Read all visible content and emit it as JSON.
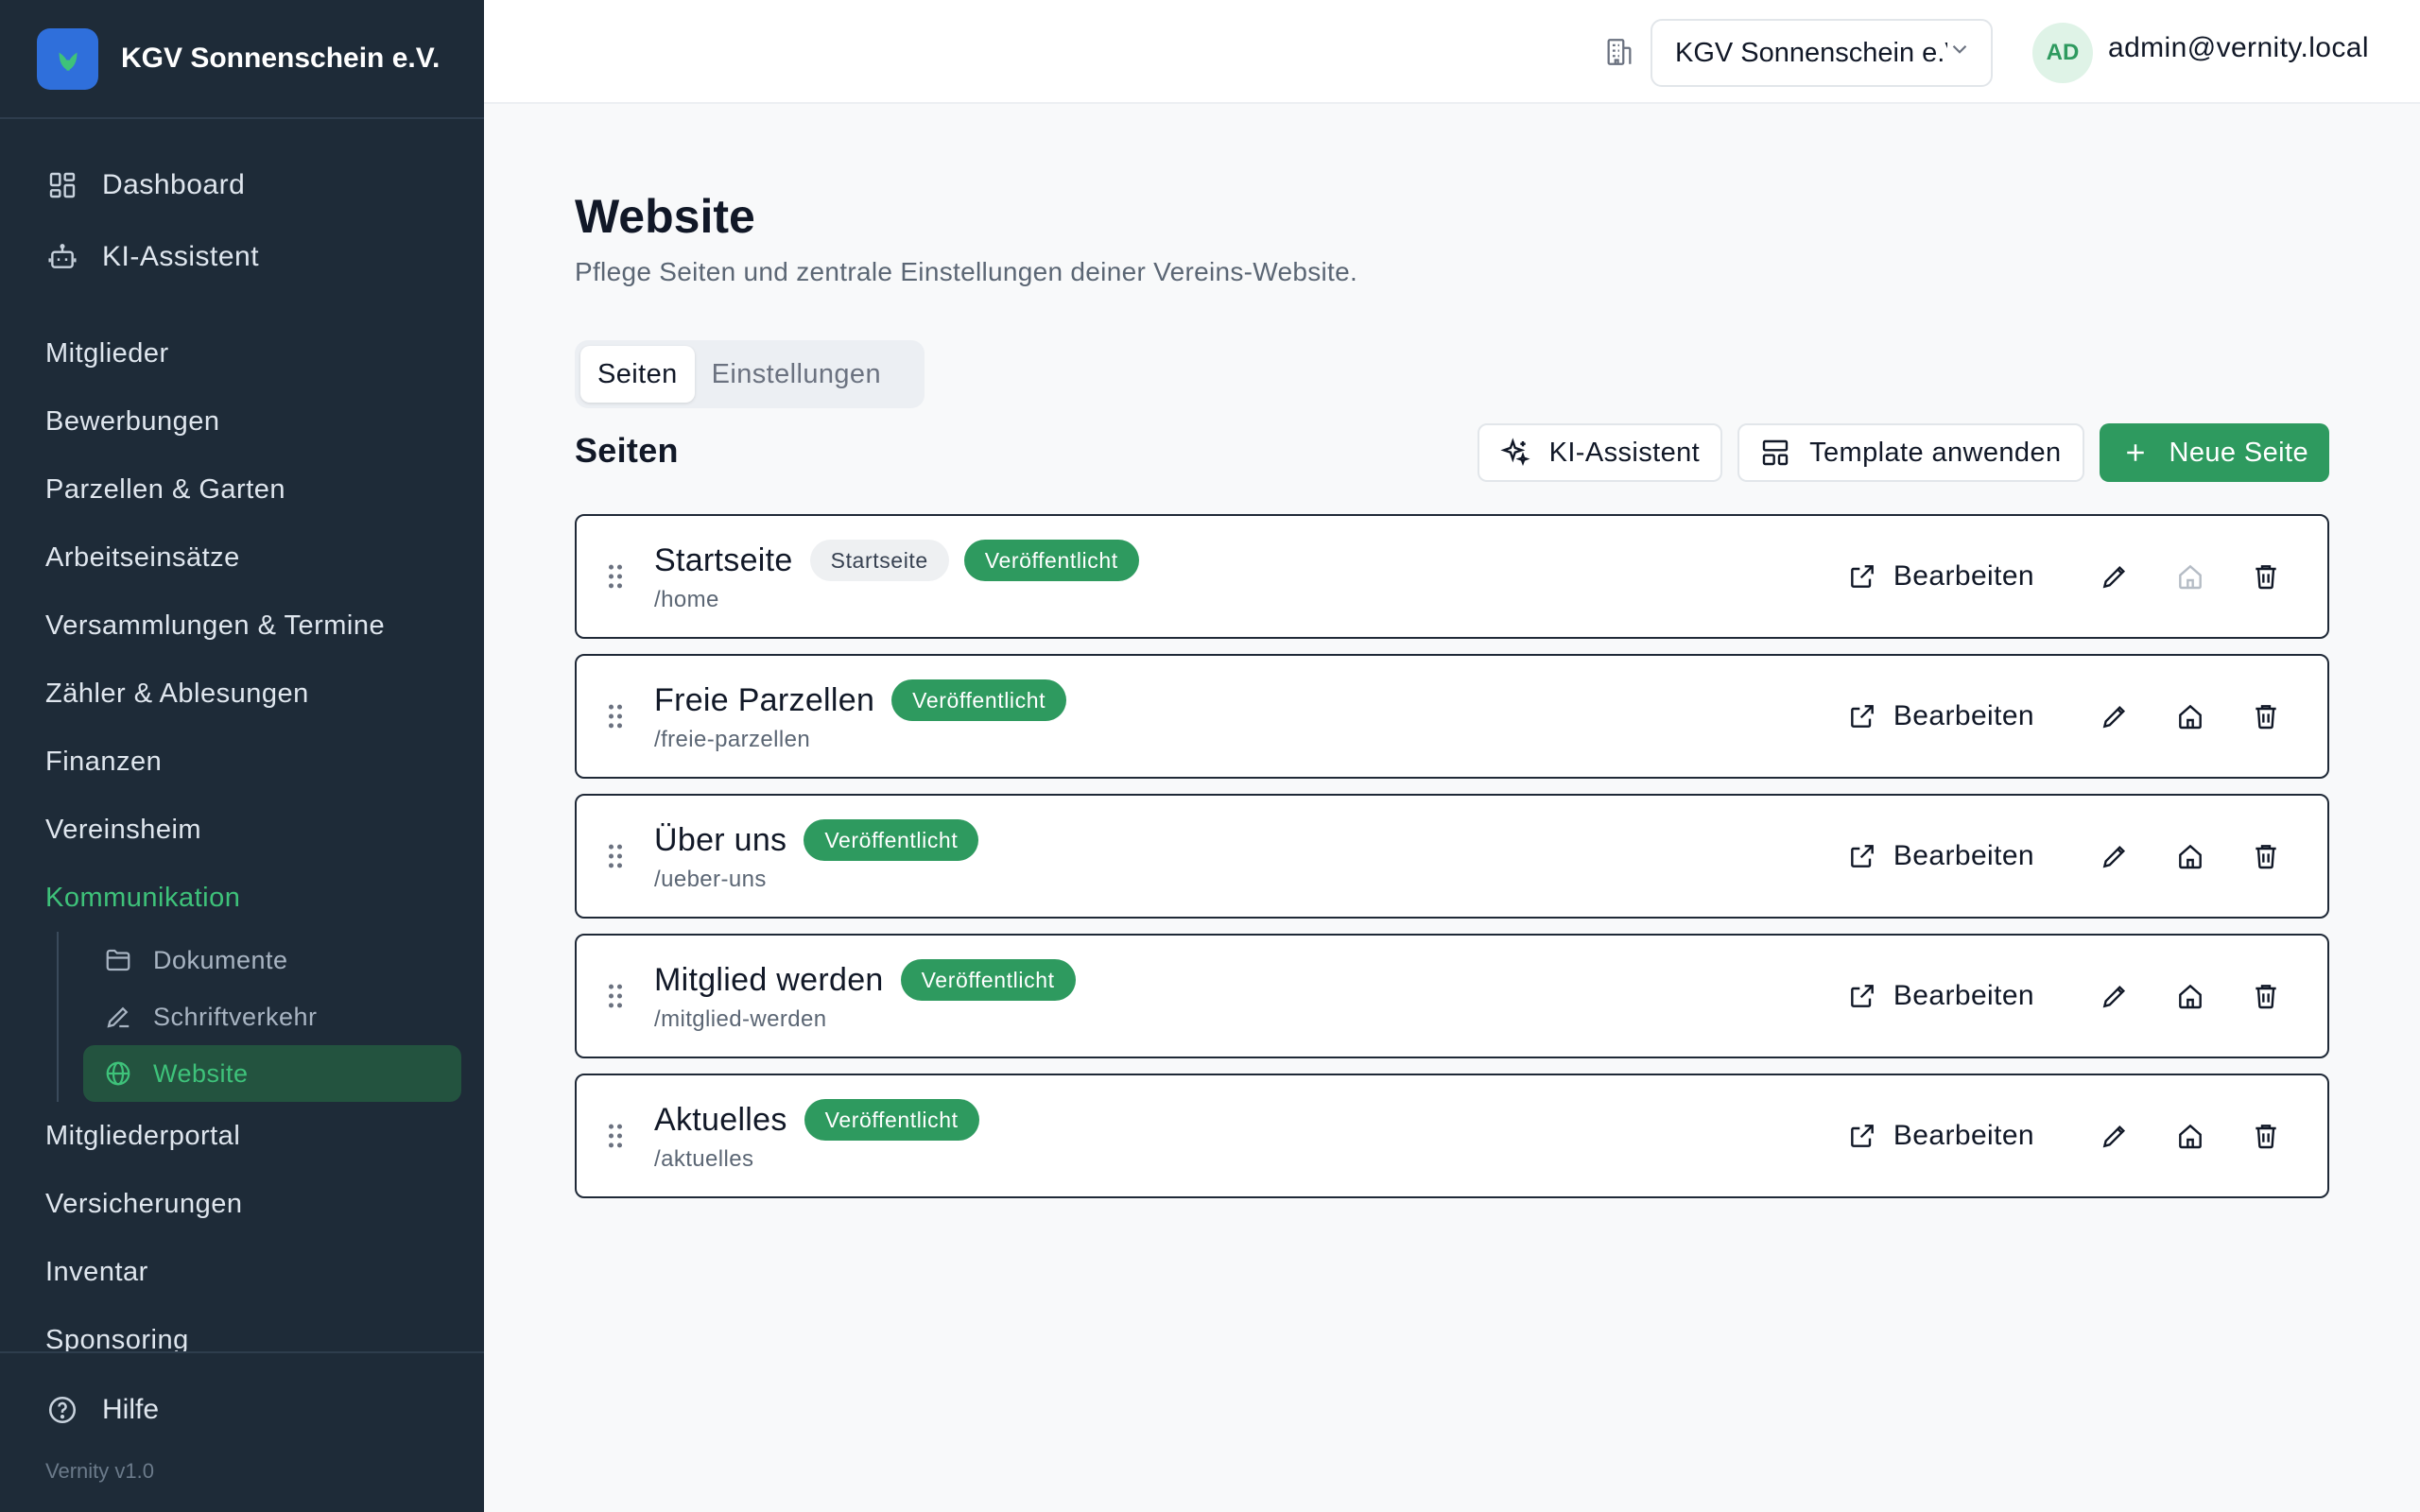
{
  "sidebar": {
    "brand": "KGV Sonnenschein e.V.",
    "top_items": [
      {
        "label": "Dashboard",
        "icon": "dashboard-icon"
      },
      {
        "label": "KI-Assistent",
        "icon": "bot-icon"
      }
    ],
    "items": [
      "Mitglieder",
      "Bewerbungen",
      "Parzellen & Garten",
      "Arbeitseinsätze",
      "Versammlungen & Termine",
      "Zähler & Ablesungen",
      "Finanzen",
      "Vereinsheim",
      "Kommunikation"
    ],
    "sub_items": [
      {
        "label": "Dokumente",
        "icon": "folder-icon"
      },
      {
        "label": "Schriftverkehr",
        "icon": "pen-icon"
      },
      {
        "label": "Website",
        "icon": "globe-icon"
      }
    ],
    "items_after": [
      "Mitgliederportal",
      "Versicherungen",
      "Inventar",
      "Sponsoring"
    ],
    "help": "Hilfe",
    "version": "Vernity v1.0",
    "active_color": "#3ec27a"
  },
  "topbar": {
    "org_select": "KGV Sonnenschein e.V.",
    "avatar_initials": "AD",
    "user_email": "admin@vernity.local"
  },
  "main": {
    "title": "Website",
    "subtitle": "Pflege Seiten und zentrale Einstellungen deiner Vereins-Website.",
    "tabs": [
      "Seiten",
      "Einstellungen"
    ],
    "section_title": "Seiten",
    "buttons": {
      "ai": "KI-Assistent",
      "template": "Template anwenden",
      "new_page": "Neue Seite"
    },
    "edit_label": "Bearbeiten",
    "pages": [
      {
        "title": "Startseite",
        "home_badge": "Startseite",
        "status": "Veröffentlicht",
        "slug": "/home"
      },
      {
        "title": "Freie Parzellen",
        "status": "Veröffentlicht",
        "slug": "/freie-parzellen"
      },
      {
        "title": "Über uns",
        "status": "Veröffentlicht",
        "slug": "/ueber-uns"
      },
      {
        "title": "Mitglied werden",
        "status": "Veröffentlicht",
        "slug": "/mitglied-werden"
      },
      {
        "title": "Aktuelles",
        "status": "Veröffentlicht",
        "slug": "/aktuelles"
      }
    ],
    "accent_color": "#2e9a5f"
  }
}
